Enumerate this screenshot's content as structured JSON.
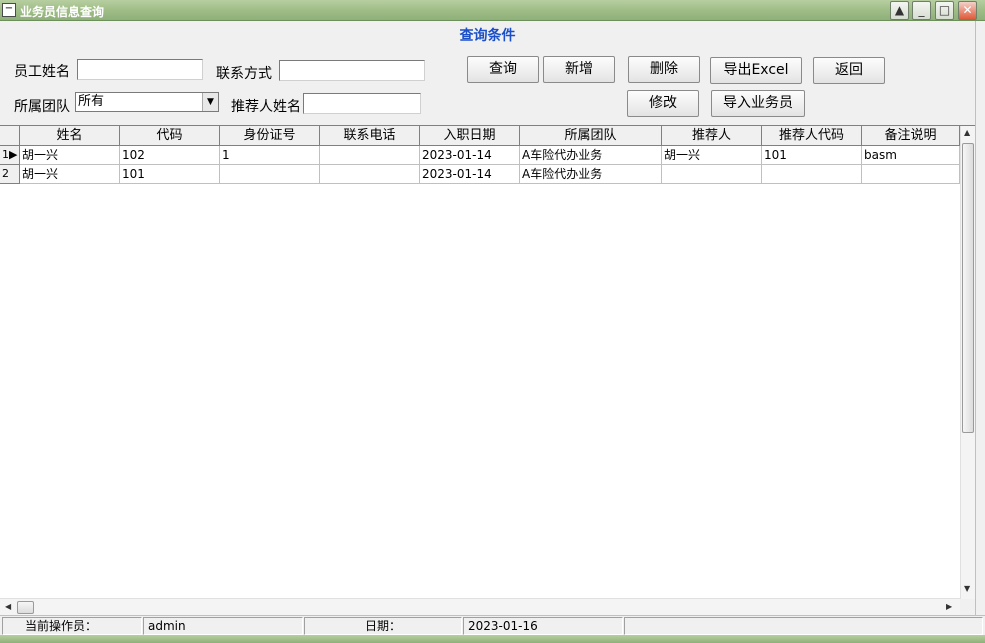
{
  "window": {
    "title": "业务员信息查询",
    "sysmenu_icon": "window-menu-icon",
    "minimize_btn": "▲",
    "restore_btn": "_",
    "maximize_btn": "□",
    "close_btn": "✕"
  },
  "query": {
    "panel_title": "查询条件",
    "name_label": "员工姓名",
    "name_value": "",
    "contact_label": "联系方式",
    "contact_value": "",
    "team_label": "所属团队",
    "team_value": "所有",
    "referrer_label": "推荐人姓名",
    "referrer_value": "",
    "buttons": {
      "search": "查询",
      "add": "新增",
      "delete": "删除",
      "export": "导出Excel",
      "back": "返回",
      "edit": "修改",
      "import": "导入业务员"
    }
  },
  "grid": {
    "columns": [
      "姓名",
      "代码",
      "身份证号",
      "联系电话",
      "入职日期",
      "所属团队",
      "推荐人",
      "推荐人代码",
      "备注说明"
    ],
    "rows": [
      {
        "index": "1",
        "cells": [
          "胡一兴",
          "102",
          "1",
          "",
          "2023-01-14",
          "A车险代办业务",
          "胡一兴",
          "101",
          "basm"
        ]
      },
      {
        "index": "2",
        "cells": [
          "胡一兴",
          "101",
          "",
          "",
          "2023-01-14",
          "A车险代办业务",
          "",
          "",
          ""
        ]
      }
    ]
  },
  "status": {
    "operator_label": "当前操作员：",
    "operator_value": "admin",
    "date_label": "日期：",
    "date_value": "2023-01-16"
  }
}
